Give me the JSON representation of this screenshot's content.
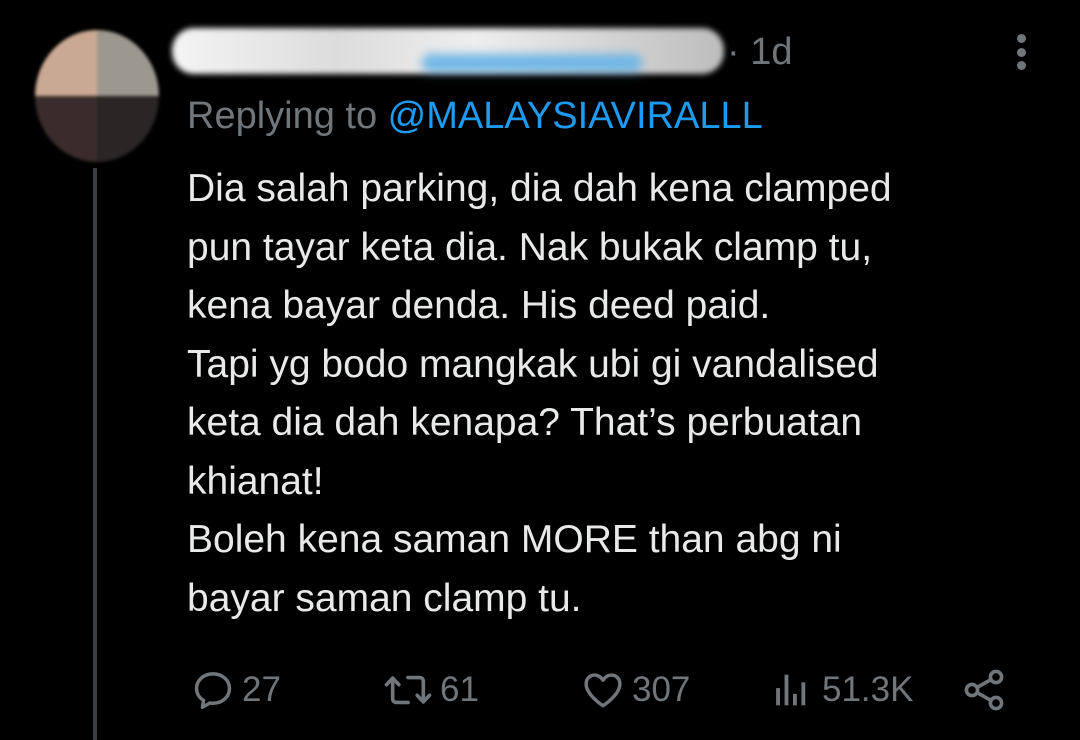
{
  "tweet": {
    "timestamp": "· 1d",
    "replying_prefix": "Replying to ",
    "replying_handle": "@MALAYSIAVIRALLL",
    "body_lines": [
      "Dia salah parking, dia dah kena clamped",
      "pun tayar keta dia. Nak bukak clamp tu,",
      "kena bayar denda. His deed paid.",
      "Tapi yg bodo mangkak ubi gi vandalised",
      "keta dia dah kenapa? That’s perbuatan",
      "khianat!",
      "Boleh kena saman MORE than abg ni",
      "bayar saman clamp tu."
    ]
  },
  "actions": {
    "reply": {
      "icon": "reply-icon",
      "count": "27"
    },
    "retweet": {
      "icon": "retweet-icon",
      "count": "61"
    },
    "like": {
      "icon": "heart-icon",
      "count": "307"
    },
    "views": {
      "icon": "views-icon",
      "count": "51.3K"
    },
    "share": {
      "icon": "share-icon"
    }
  },
  "colors": {
    "background": "#000000",
    "text": "#e7e9ea",
    "muted": "#71767b",
    "link": "#1d9bf0",
    "thread_line": "#3a3d41"
  }
}
